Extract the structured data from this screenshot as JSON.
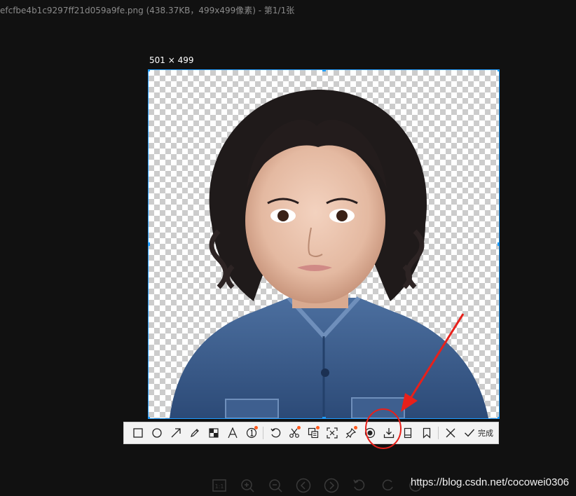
{
  "window": {
    "title": "efcfbe4b1c9297ff21d059a9fe.png (438.37KB，499x499像素) - 第1/1张"
  },
  "selection": {
    "size_label": "501 × 499"
  },
  "toolbar": {
    "tools": [
      {
        "name": "rectangle-tool",
        "icon": "rectangle-icon"
      },
      {
        "name": "ellipse-tool",
        "icon": "circle-icon"
      },
      {
        "name": "arrow-tool",
        "icon": "arrow-icon"
      },
      {
        "name": "pen-tool",
        "icon": "pencil-icon"
      },
      {
        "name": "mosaic-tool",
        "icon": "mosaic-icon"
      },
      {
        "name": "text-tool",
        "icon": "text-icon"
      },
      {
        "name": "number-tool",
        "icon": "number-icon"
      },
      {
        "name": "undo-tool",
        "icon": "undo-icon"
      },
      {
        "name": "cutout-tool",
        "icon": "scissors-icon"
      },
      {
        "name": "ocr-tool",
        "icon": "ocr-icon"
      },
      {
        "name": "scan-tool",
        "icon": "scan-icon"
      },
      {
        "name": "pin-tool",
        "icon": "pin-icon"
      },
      {
        "name": "record-tool",
        "icon": "record-icon"
      },
      {
        "name": "save-tool",
        "icon": "download-icon"
      },
      {
        "name": "device-tool",
        "icon": "phone-icon"
      },
      {
        "name": "bookmark-tool",
        "icon": "bookmark-icon"
      },
      {
        "name": "cancel-tool",
        "icon": "close-icon"
      }
    ],
    "done_label": "完成"
  },
  "viewer_controls": {
    "actual_size_label": "1:1"
  },
  "watermark": "https://blog.csdn.net/cocowei0306",
  "colors": {
    "selection_border": "#1e9bff",
    "annotation_red": "#e8201a",
    "badge_orange": "#ff5a1f"
  }
}
